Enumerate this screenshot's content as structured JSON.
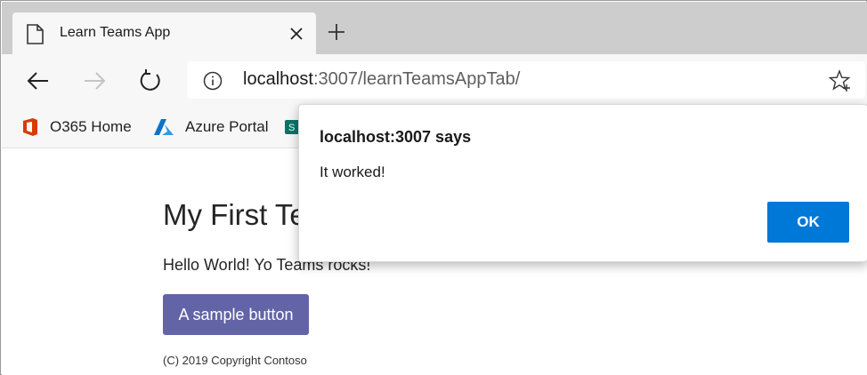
{
  "browser": {
    "tab": {
      "title": "Learn Teams App",
      "page_icon": "page-icon",
      "close_icon": "close-icon"
    },
    "new_tab_icon": "plus-icon",
    "nav": {
      "back_icon": "arrow-left-icon",
      "forward_icon": "arrow-right-icon",
      "refresh_icon": "refresh-icon"
    },
    "address": {
      "host": "localhost",
      "rest": ":3007/learnTeamsAppTab/",
      "info_icon": "info-icon",
      "favorite_icon": "star-add-icon"
    },
    "favorites": [
      {
        "label": "O365 Home",
        "icon": "office-icon"
      },
      {
        "label": "Azure Portal",
        "icon": "azure-icon"
      },
      {
        "label": "",
        "icon": "sharepoint-icon"
      }
    ]
  },
  "page": {
    "title": "My First Te",
    "hello": "Hello World! Yo Teams rocks!",
    "button_label": "A sample button",
    "copyright": "(C) 2019 Copyright Contoso"
  },
  "dialog": {
    "title": "localhost:3007 says",
    "message": "It worked!",
    "ok_label": "OK"
  },
  "colors": {
    "teams_purple": "#6264a7",
    "ok_blue": "#0078d7",
    "office_orange": "#d83b01",
    "azure_blue": "#0a72c8",
    "sharepoint_teal": "#077568"
  }
}
